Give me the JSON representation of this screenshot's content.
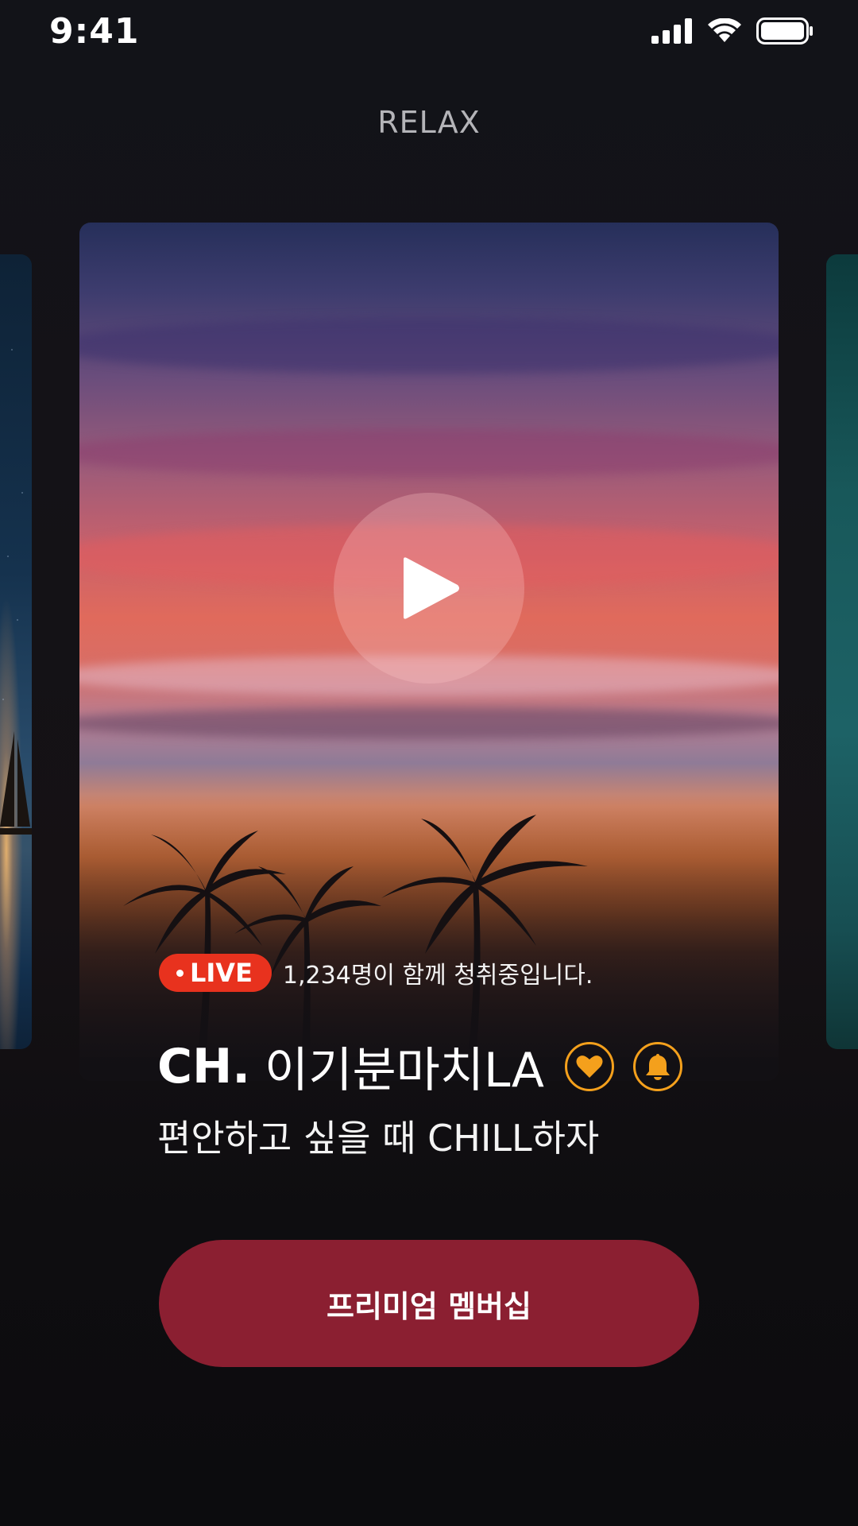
{
  "status_bar": {
    "time": "9:41",
    "icons": [
      "cellular-signal-icon",
      "wifi-icon",
      "battery-icon"
    ]
  },
  "header": {
    "title": "RELAX"
  },
  "live": {
    "badge": "LIVE",
    "listeners_text": "1,234명이 함께 청취중입니다."
  },
  "channel": {
    "prefix": "CH.",
    "name": "이기분마치LA",
    "subtitle": "편안하고 싶을 때 CHILL하자",
    "icons": [
      "heart-icon",
      "bell-icon"
    ]
  },
  "cta": {
    "label": "프리미엄 멤버십"
  },
  "colors": {
    "background": "#0d0d0f",
    "live_red": "#e8321e",
    "accent_orange": "#f4a01c",
    "premium_button": "#8b1f31"
  }
}
